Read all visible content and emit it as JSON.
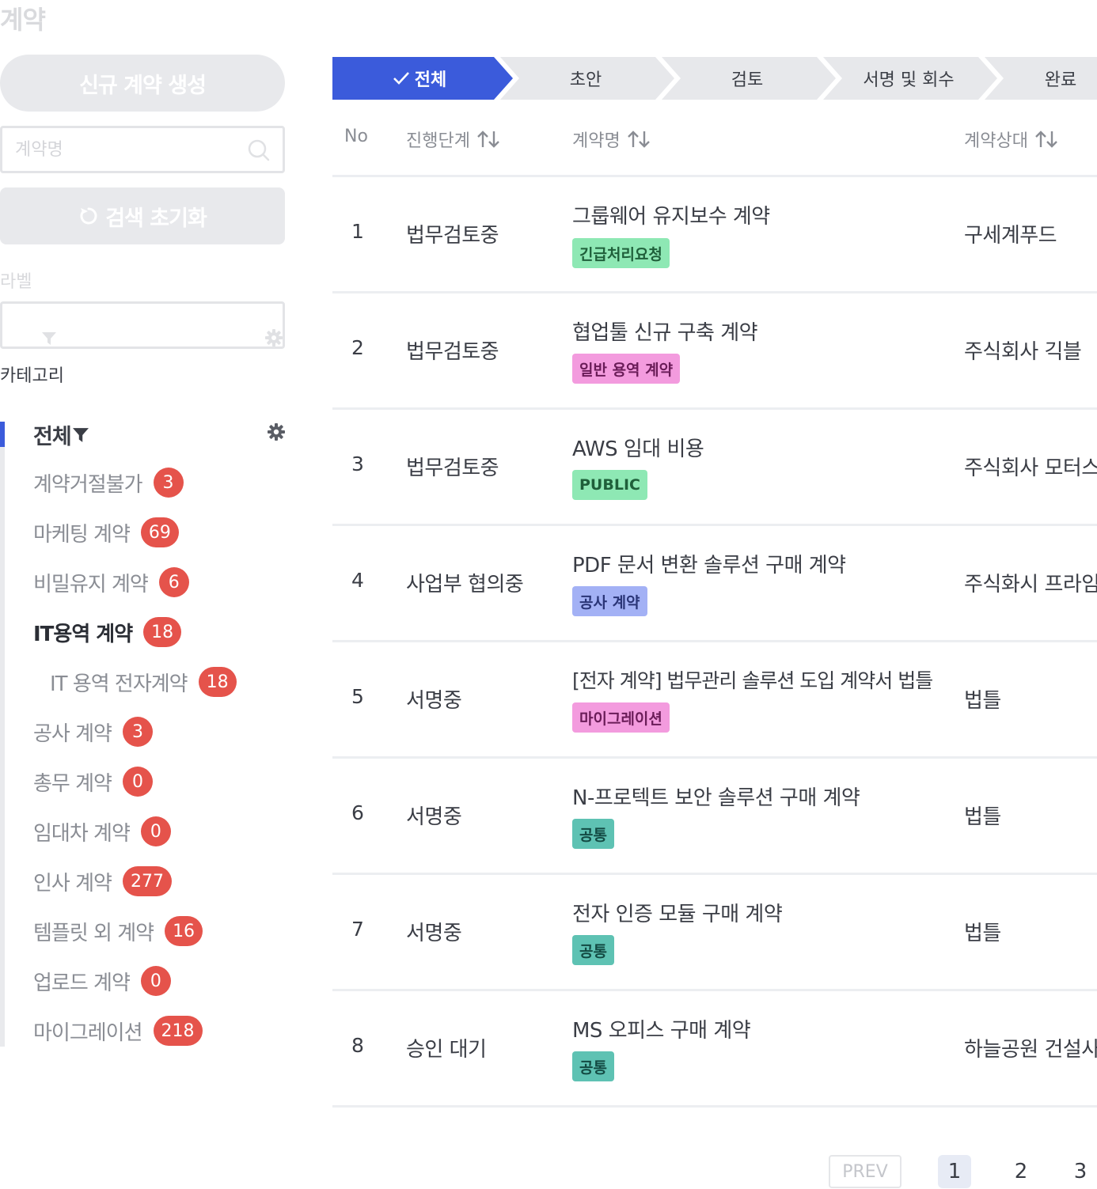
{
  "page": {
    "title": "계약"
  },
  "sidebar": {
    "new_button": "신규 계약 생성",
    "search": {
      "placeholder": "계약명",
      "value": ""
    },
    "reset_button": "검색 초기화",
    "label_heading": "라벨",
    "category_heading": "카테고리",
    "all_label": "전체",
    "categories": [
      {
        "label": "계약거절불가",
        "count": "3"
      },
      {
        "label": "마케팅 계약",
        "count": "69"
      },
      {
        "label": "비밀유지 계약",
        "count": "6"
      },
      {
        "label": "IT용역 계약",
        "count": "18"
      },
      {
        "label": "IT 용역 전자계약",
        "count": "18"
      },
      {
        "label": "공사 계약",
        "count": "3"
      },
      {
        "label": "총무 계약",
        "count": "0"
      },
      {
        "label": "임대차 계약",
        "count": "0"
      },
      {
        "label": "인사 계약",
        "count": "277"
      },
      {
        "label": "템플릿 외 계약",
        "count": "16"
      },
      {
        "label": "업로드 계약",
        "count": "0"
      },
      {
        "label": "마이그레이션",
        "count": "218"
      }
    ]
  },
  "steps": [
    {
      "label": "전체",
      "active": true
    },
    {
      "label": "초안",
      "active": false
    },
    {
      "label": "검토",
      "active": false
    },
    {
      "label": "서명 및 회수",
      "active": false
    },
    {
      "label": "완료",
      "active": false
    }
  ],
  "table": {
    "headers": {
      "no": "No",
      "stage": "진행단계",
      "name": "계약명",
      "party": "계약상대"
    },
    "rows": [
      {
        "no": "1",
        "stage": "법무검토중",
        "name": "그룹웨어 유지보수 계약",
        "tag": "긴급처리요청",
        "tag_bg": "#8ee8b4",
        "tag_fg": "#1f5f3a",
        "party": "구세계푸드"
      },
      {
        "no": "2",
        "stage": "법무검토중",
        "name": "협업툴 신규 구축 계약",
        "tag": "일반 용역 계약",
        "tag_bg": "#f39bde",
        "tag_fg": "#6a1c58",
        "party": "주식회사 긱블"
      },
      {
        "no": "3",
        "stage": "법무검토중",
        "name": "AWS 임대 비용",
        "tag": "PUBLIC",
        "tag_bg": "#8ee8b4",
        "tag_fg": "#1f5f3a",
        "party": "주식회사 모터스"
      },
      {
        "no": "4",
        "stage": "사업부 협의중",
        "name": "PDF 문서 변환 솔루션 구매 계약",
        "tag": "공사 계약",
        "tag_bg": "#a3b1f5",
        "tag_fg": "#2a3577",
        "party": "주식화시 프라임"
      },
      {
        "no": "5",
        "stage": "서명중",
        "name": "[전자 계약] 법무관리 솔루션 도입 계약서 법틀",
        "tag": "마이그레이션",
        "tag_bg": "#f39bde",
        "tag_fg": "#6a1c58",
        "party": "법틀"
      },
      {
        "no": "6",
        "stage": "서명중",
        "name": "N-프로텍트 보안 솔루션 구매 계약",
        "tag": "공통",
        "tag_bg": "#5ec2b3",
        "tag_fg": "#134a43",
        "party": "법틀"
      },
      {
        "no": "7",
        "stage": "서명중",
        "name": "전자 인증 모듈 구매 계약",
        "tag": "공통",
        "tag_bg": "#5ec2b3",
        "tag_fg": "#134a43",
        "party": "법틀"
      },
      {
        "no": "8",
        "stage": "승인 대기",
        "name": "MS 오피스 구매 계약",
        "tag": "공통",
        "tag_bg": "#5ec2b3",
        "tag_fg": "#134a43",
        "party": "하늘공원 건설사"
      }
    ]
  },
  "pagination": {
    "prev": "PREV",
    "pages": [
      "1",
      "2",
      "3"
    ],
    "current": "1"
  },
  "colors": {
    "accent": "#3b5bdb",
    "badge": "#e5534b",
    "step_inactive": "#e7e8eb"
  }
}
